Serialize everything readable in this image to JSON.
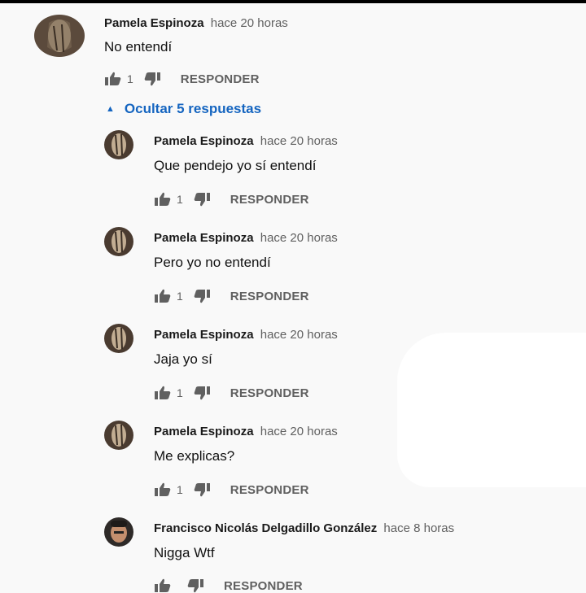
{
  "comments": [
    {
      "author": "Pamela Espinoza",
      "time": "hace 20 horas",
      "text": "No entendí",
      "likes": "1",
      "reply_label": "RESPONDER"
    },
    {
      "author": "Pamela Espinoza",
      "time": "hace 20 horas",
      "text": "Que pendejo yo sí entendí",
      "likes": "1",
      "reply_label": "RESPONDER"
    },
    {
      "author": "Pamela Espinoza",
      "time": "hace 20 horas",
      "text": "Pero yo no entendí",
      "likes": "1",
      "reply_label": "RESPONDER"
    },
    {
      "author": "Pamela Espinoza",
      "time": "hace 20 horas",
      "text": "Jaja yo sí",
      "likes": "1",
      "reply_label": "RESPONDER"
    },
    {
      "author": "Pamela Espinoza",
      "time": "hace 20 horas",
      "text": "Me explicas?",
      "likes": "1",
      "reply_label": "RESPONDER"
    },
    {
      "author": "Francisco Nicolás Delgadillo González",
      "time": "hace 8 horas",
      "text": "Nigga Wtf",
      "likes": "",
      "reply_label": "RESPONDER"
    }
  ],
  "replies_toggle": "Ocultar 5 respuestas",
  "colors": {
    "link": "#1565c0",
    "meta": "#606060",
    "background": "#f9f9f9"
  },
  "icons": {
    "like": "thumbs-up-icon",
    "dislike": "thumbs-down-icon",
    "toggle": "caret-up-icon"
  }
}
